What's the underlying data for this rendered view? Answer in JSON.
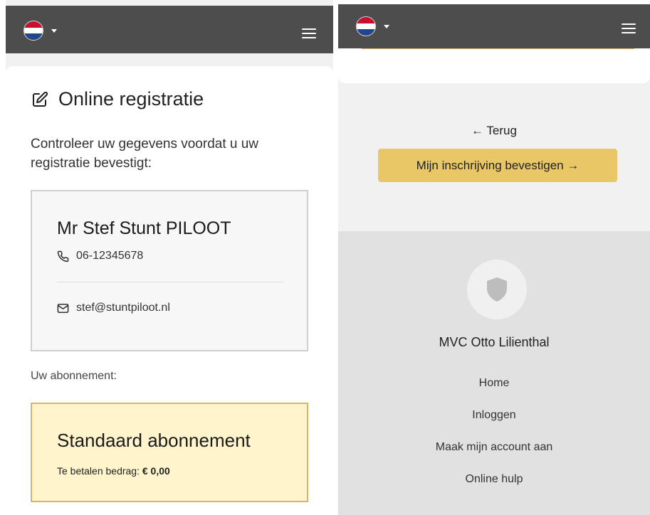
{
  "left": {
    "title": "Online registratie",
    "intro": "Controleer uw gegevens voordat u uw registratie bevestigt:",
    "person": {
      "name": "Mr Stef Stunt PILOOT",
      "phone": "06-12345678",
      "email": "stef@stuntpiloot.nl"
    },
    "subscription_label": "Uw abonnement:",
    "subscription": {
      "name": "Standaard abonnement",
      "amount_label": "Te betalen bedrag:",
      "amount_value": "€ 0,00"
    }
  },
  "right": {
    "back_label": "←  Terug",
    "confirm_label": "Mijn inschrijving bevestigen  →",
    "footer": {
      "club_name": "MVC Otto Lilienthal",
      "links": [
        "Home",
        "Inloggen",
        "Maak mijn account aan",
        "Online hulp"
      ]
    }
  },
  "icons": {
    "language": "netherlands-flag-icon",
    "menu": "hamburger-menu-icon",
    "title": "edit-icon",
    "phone": "phone-icon",
    "email": "mail-icon",
    "club_logo": "shield-icon"
  },
  "colors": {
    "topbar": "#4d4d4d",
    "confirm_button": "#e9c766",
    "subscription_background": "#fff4cc",
    "subscription_border": "#d8b46a",
    "footer_background": "#e1e1e1"
  }
}
